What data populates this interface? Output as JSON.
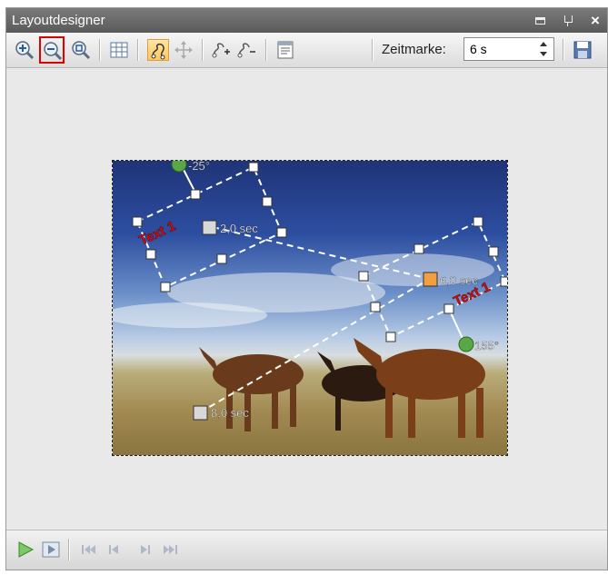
{
  "window": {
    "title": "Layoutdesigner"
  },
  "toolbar": {
    "buttons": [
      {
        "name": "zoom-in",
        "icon": "zoom-in-icon"
      },
      {
        "name": "zoom-out",
        "icon": "zoom-out-icon"
      },
      {
        "name": "zoom-fit",
        "icon": "zoom-fit-icon"
      },
      {
        "name": "grid",
        "icon": "grid-icon"
      },
      {
        "name": "path",
        "icon": "motion-path-icon"
      },
      {
        "name": "move",
        "icon": "move-icon"
      },
      {
        "name": "add-point",
        "icon": "add-keyframe-icon"
      },
      {
        "name": "remove-point",
        "icon": "remove-keyframe-icon"
      },
      {
        "name": "properties",
        "icon": "properties-icon"
      },
      {
        "name": "save",
        "icon": "save-icon"
      }
    ],
    "zeitmarke_label": "Zeitmarke:",
    "zeitmarke_value": "6 s"
  },
  "canvas": {
    "keyframe_labels": [
      "2,0 sec",
      "6,0 sec",
      "8,0 sec"
    ],
    "rotation_labels": [
      "-25°",
      "155°"
    ],
    "text_labels": [
      "Text 1",
      "Text 1"
    ],
    "colors": {
      "path": "#ffffff",
      "handle_fill": "#ffffff",
      "rotation_handle": "#5aa845",
      "text_red": "#d01010",
      "current_key": "#f0a040"
    }
  },
  "playback": {
    "buttons": [
      {
        "name": "play",
        "icon": "play-icon"
      },
      {
        "name": "preview",
        "icon": "preview-icon"
      },
      {
        "name": "first",
        "icon": "skip-first-icon"
      },
      {
        "name": "prev",
        "icon": "skip-prev-icon"
      },
      {
        "name": "next",
        "icon": "skip-next-icon"
      },
      {
        "name": "last",
        "icon": "skip-last-icon"
      }
    ]
  }
}
